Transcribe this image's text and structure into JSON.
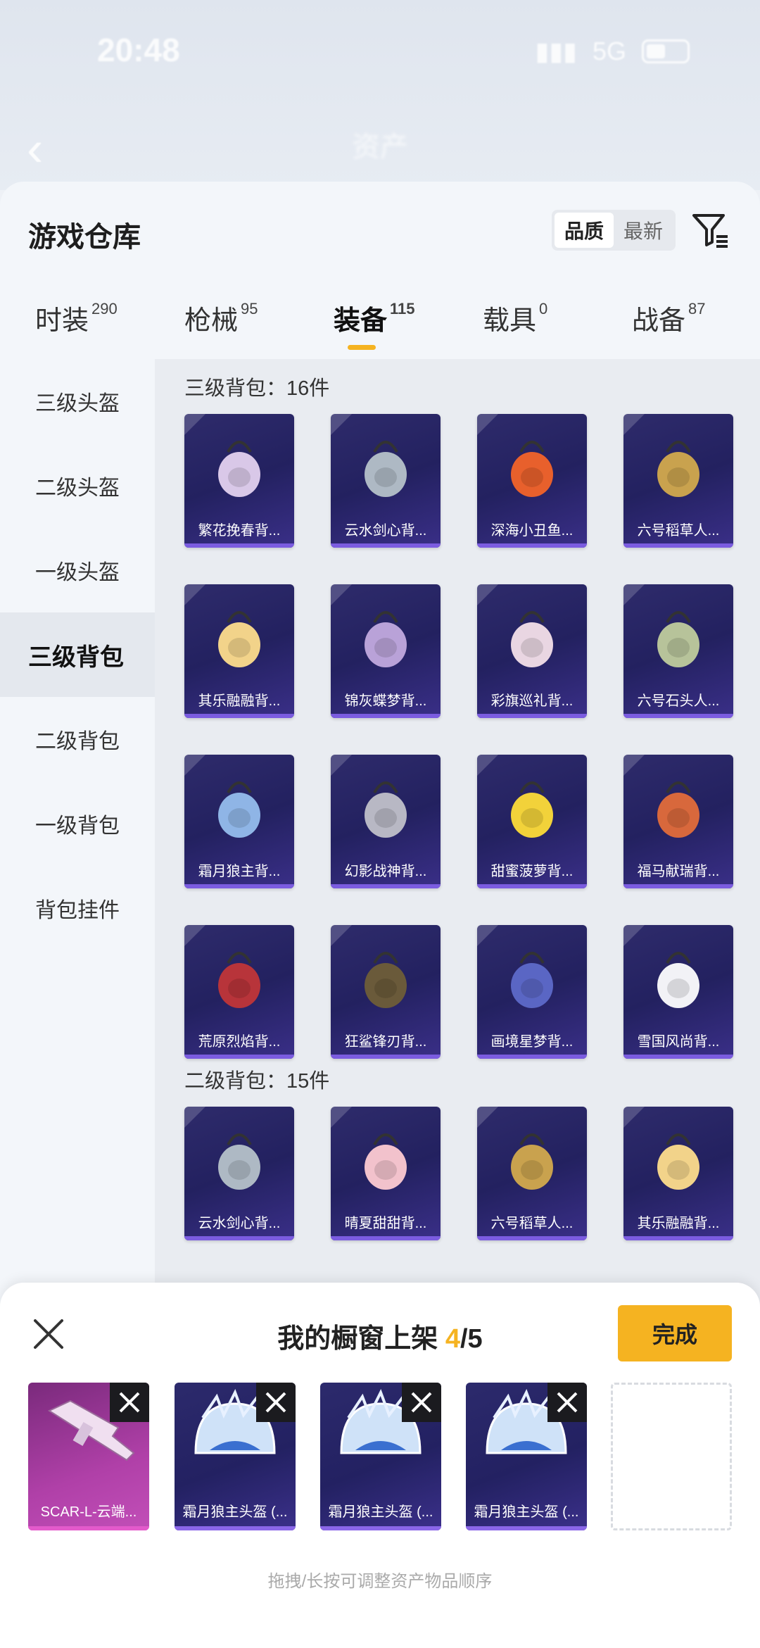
{
  "status_bar": {
    "time": "20:48",
    "network": "5G"
  },
  "background_header": {
    "title": "资产"
  },
  "sheet": {
    "title": "游戏仓库",
    "sort_options": [
      "品质",
      "最新"
    ],
    "sort_active": "品质"
  },
  "tabs": [
    {
      "label": "时装",
      "count": "290"
    },
    {
      "label": "枪械",
      "count": "95"
    },
    {
      "label": "装备",
      "count": "115",
      "active": true
    },
    {
      "label": "载具",
      "count": "0"
    },
    {
      "label": "战备",
      "count": "87"
    }
  ],
  "sidebar": {
    "items": [
      "三级头盔",
      "二级头盔",
      "一级头盔",
      "三级背包",
      "二级背包",
      "一级背包",
      "背包挂件"
    ],
    "active": "三级背包"
  },
  "sections": [
    {
      "title": "三级背包：16件",
      "items": [
        {
          "label": "繁花挽春背...",
          "color": "#d9c8e8"
        },
        {
          "label": "云水剑心背...",
          "color": "#aeb9c4"
        },
        {
          "label": "深海小丑鱼...",
          "color": "#e8602c"
        },
        {
          "label": "六号稻草人...",
          "color": "#c9a24e"
        },
        {
          "label": "其乐融融背...",
          "color": "#f2d38a"
        },
        {
          "label": "锦灰蝶梦背...",
          "color": "#b9a2d8"
        },
        {
          "label": "彩旗巡礼背...",
          "color": "#e9d6e2"
        },
        {
          "label": "六号石头人...",
          "color": "#b7c39a"
        },
        {
          "label": "霜月狼主背...",
          "color": "#8fb5e6"
        },
        {
          "label": "幻影战神背...",
          "color": "#b8b8c4"
        },
        {
          "label": "甜蜜菠萝背...",
          "color": "#f2d23a"
        },
        {
          "label": "福马献瑞背...",
          "color": "#d8683c"
        },
        {
          "label": "荒原烈焰背...",
          "color": "#b8343a"
        },
        {
          "label": "狂鲨锋刃背...",
          "color": "#6a5a3a"
        },
        {
          "label": "画境星梦背...",
          "color": "#5a66c4"
        },
        {
          "label": "雪国风尚背...",
          "color": "#f2f2f6"
        }
      ]
    },
    {
      "title": "二级背包：15件",
      "items": [
        {
          "label": "云水剑心背...",
          "color": "#aeb9c4"
        },
        {
          "label": "晴夏甜甜背...",
          "color": "#f2c2cc"
        },
        {
          "label": "六号稻草人...",
          "color": "#c9a24e"
        },
        {
          "label": "其乐融融背...",
          "color": "#f2d38a"
        }
      ]
    }
  ],
  "panel": {
    "title_prefix": "我的橱窗上架",
    "count": "4",
    "total": "/5",
    "done_label": "完成",
    "slots": [
      {
        "label": "SCAR-L-云端...",
        "kind": "gun"
      },
      {
        "label": "霜月狼主头盔 (...",
        "kind": "helm"
      },
      {
        "label": "霜月狼主头盔 (...",
        "kind": "helm"
      },
      {
        "label": "霜月狼主头盔 (...",
        "kind": "helm"
      }
    ],
    "hint": "拖拽/长按可调整资产物品顺序"
  }
}
